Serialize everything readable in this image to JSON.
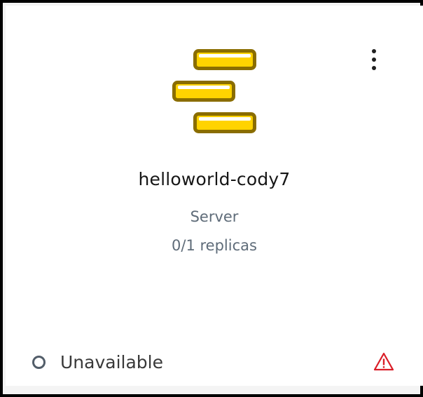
{
  "card": {
    "name": "helloworld-cody7",
    "type": "Server",
    "replicas": "0/1 replicas",
    "status": "Unavailable"
  },
  "icons": {
    "logo": "stacked-bars-logo-icon",
    "menu": "overflow-menu-icon",
    "status": "status-circle-icon",
    "warning": "warning-triangle-icon"
  },
  "colors": {
    "logo_fill": "#ffd300",
    "logo_outline": "#8a6d00",
    "warning": "#da1e28",
    "status_ring": "#525d69"
  }
}
